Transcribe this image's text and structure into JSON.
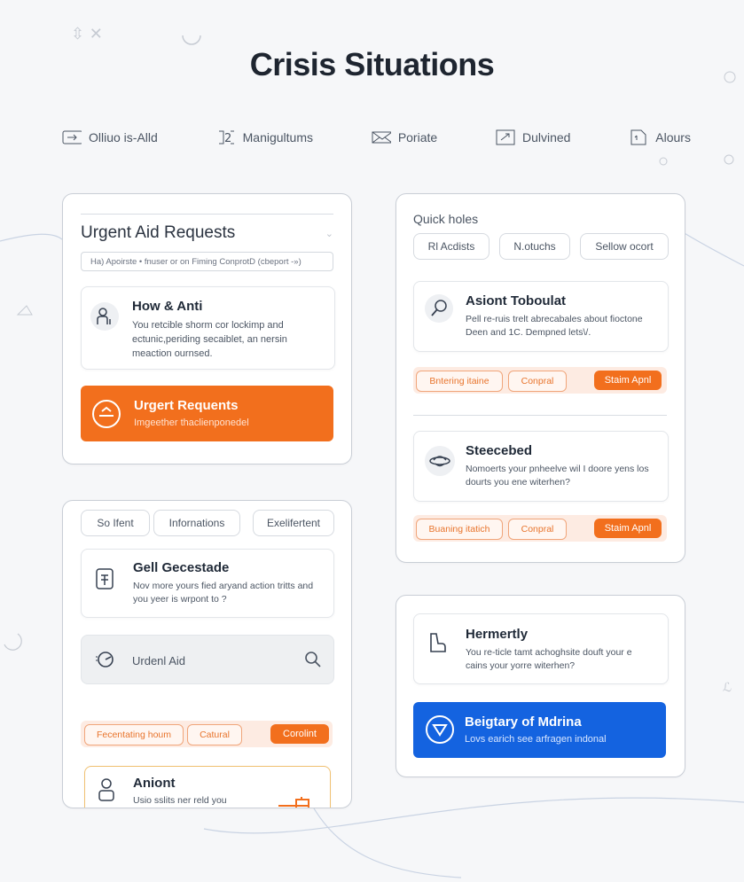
{
  "page": {
    "title": "Crisis Situations"
  },
  "topnav": [
    {
      "label": "Olliuo is-Alld",
      "icon": "arrow-right-icon"
    },
    {
      "label": "Manigultums",
      "icon": "number-two-icon"
    },
    {
      "label": "Poriate",
      "icon": "mail-icon"
    },
    {
      "label": "Dulvined",
      "icon": "expand-icon"
    },
    {
      "label": "Alours",
      "icon": "document-icon"
    }
  ],
  "urgent_card": {
    "title": "Urgent Aid Requests",
    "search_text": "Ha) Apoirste • fnuser or on Fiming ConprotD (cbeport -»)",
    "item": {
      "heading": "How & Anti",
      "body": "You retcible shorm cor lockimp and ectunic,periding secaiblet, an nersin meaction ournsed."
    },
    "banner": {
      "heading": "Urgert Requents",
      "body": "Imgeether thaclienponedel"
    }
  },
  "quick_card": {
    "title": "Quick holes",
    "pills": [
      "Rl Acdists",
      "N.otuchs",
      "Sellow ocort"
    ],
    "item1": {
      "heading": "Asiont Toboulat",
      "body": "Pell re-ruis trelt abrecabales about fioctone Deen and 1C. Dempned lets\\/."
    },
    "tags1": [
      "Bntering itaine",
      "Conpral",
      "Staim Apnl"
    ],
    "item2": {
      "heading": "Steecebed",
      "body": "Nomoerts your pnheelve wil I doore yens los dourts you ene witerhen?"
    },
    "tags2": [
      "Buaning itatich",
      "Conpral",
      "Staim Apnl"
    ]
  },
  "info_card": {
    "pills": [
      "So Ifent",
      "Infornations",
      "Exelifertent"
    ],
    "item": {
      "heading": "Gell Gecestade",
      "body": "Nov more yours fied aryand action tritts and you yeer is wrpont to ?"
    },
    "search": {
      "label": "Urdenl Aid"
    },
    "tags": [
      "Fecentating houm",
      "Catural",
      "Corolint"
    ],
    "bottom_item": {
      "heading": "Aniont",
      "body": "Usio sslits ner reld you"
    }
  },
  "herm_card": {
    "item": {
      "heading": "Hermertly",
      "body": "You re-ticle tamt achoghsite douft your e cains your yorre witerhen?"
    },
    "banner": {
      "heading": "Beigtary of Mdrina",
      "body": "Lovs earich see arfragen indonal"
    }
  },
  "colors": {
    "accent_orange": "#f26f1d",
    "accent_blue": "#1463e0",
    "tag_bg": "#fdebe2"
  }
}
